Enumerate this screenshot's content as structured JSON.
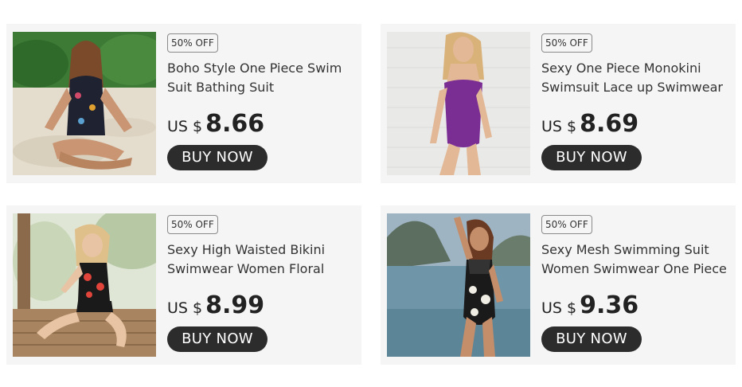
{
  "products": [
    {
      "badge": "50% OFF",
      "title": "Boho Style One Piece Swim Suit Bathing Suit",
      "currency": "US $",
      "price": "8.66",
      "button": "BUY NOW"
    },
    {
      "badge": "50% OFF",
      "title": "Sexy One Piece Monokini Swimsuit Lace up Swimwear",
      "currency": "US $",
      "price": "8.69",
      "button": "BUY NOW"
    },
    {
      "badge": "50% OFF",
      "title": "Sexy High Waisted Bikini Swimwear Women Floral",
      "currency": "US $",
      "price": "8.99",
      "button": "BUY NOW"
    },
    {
      "badge": "50% OFF",
      "title": "Sexy Mesh Swimming Suit Women Swimwear One Piece",
      "currency": "US $",
      "price": "9.36",
      "button": "BUY NOW"
    }
  ],
  "colors": {
    "card_background": "#f5f5f5",
    "button_background": "#2c2c2c",
    "button_text": "#ffffff",
    "badge_border": "#8a8a8a",
    "text": "#333333"
  }
}
